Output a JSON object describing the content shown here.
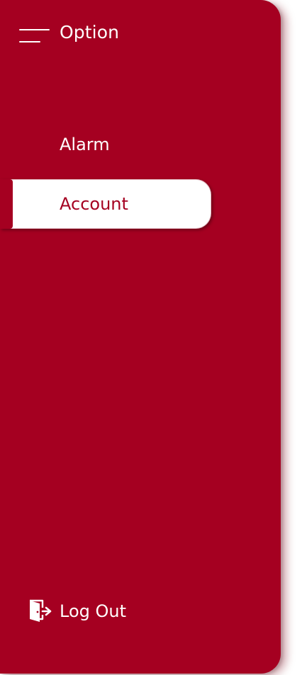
{
  "header": {
    "title": "Option",
    "menu_icon": "hamburger-menu-icon"
  },
  "nav": {
    "items": [
      {
        "label": "Alarm",
        "active": false
      },
      {
        "label": "Account",
        "active": true
      }
    ]
  },
  "footer": {
    "logout_label": "Log Out",
    "logout_icon": "logout-icon"
  },
  "colors": {
    "drawer_background": "#a50021",
    "active_item_background": "#ffffff",
    "active_item_text": "#a50021",
    "text": "#ffffff"
  }
}
